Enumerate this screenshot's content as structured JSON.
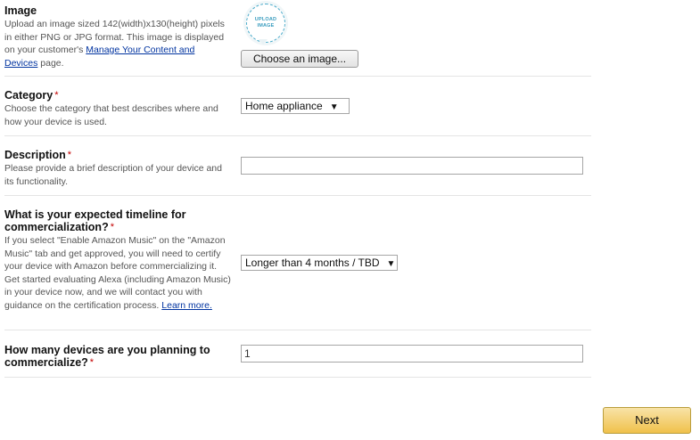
{
  "image_section": {
    "label": "Image",
    "help_text": "Upload an image sized 142(width)x130(height) pixels in either PNG or JPG format. This image is displayed on your customer's ",
    "help_link": "Manage Your Content and Devices",
    "help_suffix": " page.",
    "upload_badge_line1": "UPLOAD",
    "upload_badge_line2": "IMAGE",
    "choose_button": "Choose an image..."
  },
  "category_section": {
    "label": "Category",
    "required_mark": "*",
    "help_text": "Choose the category that best describes where and how your device is used.",
    "selected_value": "Home appliance"
  },
  "description_section": {
    "label": "Description",
    "required_mark": "*",
    "help_text": "Please provide a brief description of your device and its functionality.",
    "value": ""
  },
  "timeline_section": {
    "label": "What is your expected timeline for commercialization?",
    "required_mark": "*",
    "help_text": "If you select \"Enable Amazon Music\" on the \"Amazon Music\" tab and get approved, you will need to certify your device with Amazon before commercializing it. Get started evaluating Alexa (including Amazon Music) in your device now, and we will contact you with guidance on the certification process. ",
    "help_link": "Learn more.",
    "selected_value": "Longer than 4 months / TBD"
  },
  "devices_section": {
    "label": "How many devices are you planning to commercialize?",
    "required_mark": "*",
    "value": "1"
  },
  "footer": {
    "next_button": "Next"
  },
  "colors": {
    "required": "#c40000",
    "link": "#0033a0",
    "next_button": "#f0c14b",
    "upload_badge": "#3a9dbf"
  }
}
